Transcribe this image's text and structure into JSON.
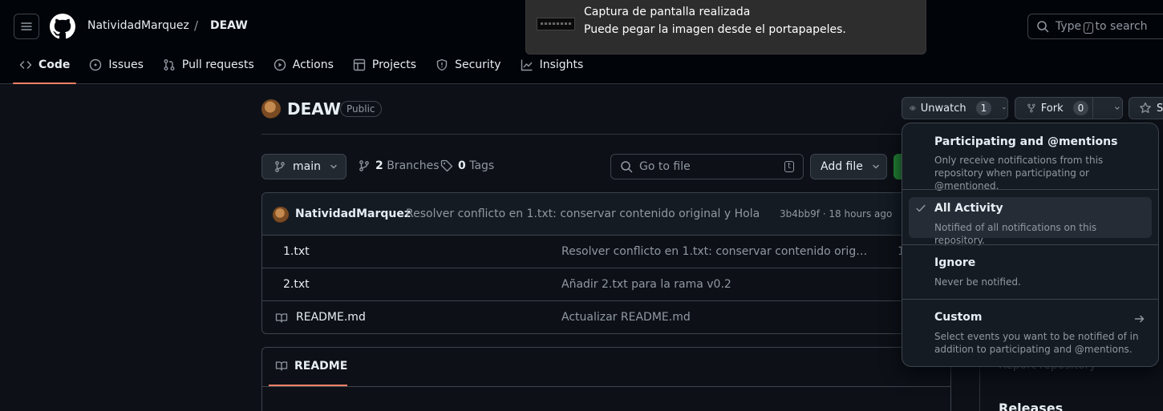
{
  "header": {
    "owner": "NatividadMarquez",
    "separator": "/",
    "repo": "DEAW",
    "search_prefix": "Type",
    "search_key": "/",
    "search_suffix": "to search"
  },
  "nav": {
    "tabs": [
      {
        "label": "Code",
        "icon": "code-icon",
        "active": true
      },
      {
        "label": "Issues",
        "icon": "issue-icon"
      },
      {
        "label": "Pull requests",
        "icon": "pull-request-icon"
      },
      {
        "label": "Actions",
        "icon": "play-icon"
      },
      {
        "label": "Projects",
        "icon": "table-icon"
      },
      {
        "label": "Security",
        "icon": "shield-icon"
      },
      {
        "label": "Insights",
        "icon": "graph-icon"
      }
    ]
  },
  "toast": {
    "title": "Captura de pantalla realizada",
    "body": "Puede pegar la imagen desde el portapapeles."
  },
  "repo_header": {
    "name": "DEAW",
    "visibility": "Public",
    "watch_label": "Unwatch",
    "watch_count": "1",
    "fork_label": "Fork",
    "fork_count": "0",
    "star_label": "S"
  },
  "file_bar": {
    "branch": "main",
    "branches_count": "2",
    "branches_label": "Branches",
    "tags_count": "0",
    "tags_label": "Tags",
    "goto_placeholder": "Go to file",
    "goto_key": "t",
    "add_file": "Add file"
  },
  "latest_commit": {
    "author": "NatividadMarquez",
    "message": "Resolver conflicto en 1.txt: conservar contenido original y Hola",
    "meta": "3b4bb9f · 18 hours ago"
  },
  "files": [
    {
      "name": "1.txt",
      "message": "Resolver conflicto en 1.txt: conservar contenido original y Hola",
      "extra": "1"
    },
    {
      "name": "2.txt",
      "message": "Añadir 2.txt para la rama v0.2",
      "extra": ""
    },
    {
      "name": "README.md",
      "message": "Actualizar README.md",
      "extra": "",
      "icon": "book-icon"
    }
  ],
  "readme": {
    "tab_label": "README"
  },
  "sidebar": {
    "report": "Report repository",
    "releases": "Releases"
  },
  "watch_menu": {
    "options": [
      {
        "title": "Participating and @mentions",
        "desc": "Only receive notifications from this repository when participating or @mentioned."
      },
      {
        "title": "All Activity",
        "desc": "Notified of all notifications on this repository.",
        "selected": true
      },
      {
        "title": "Ignore",
        "desc": "Never be notified."
      },
      {
        "title": "Custom",
        "desc": "Select events you want to be notified of in addition to participating and @mentions."
      }
    ]
  },
  "colors": {
    "background": "#0d1117",
    "header_bg": "#010409",
    "accent_underline": "#f78166",
    "code_button": "#238636",
    "toast_bg": "#2d2d2d"
  }
}
